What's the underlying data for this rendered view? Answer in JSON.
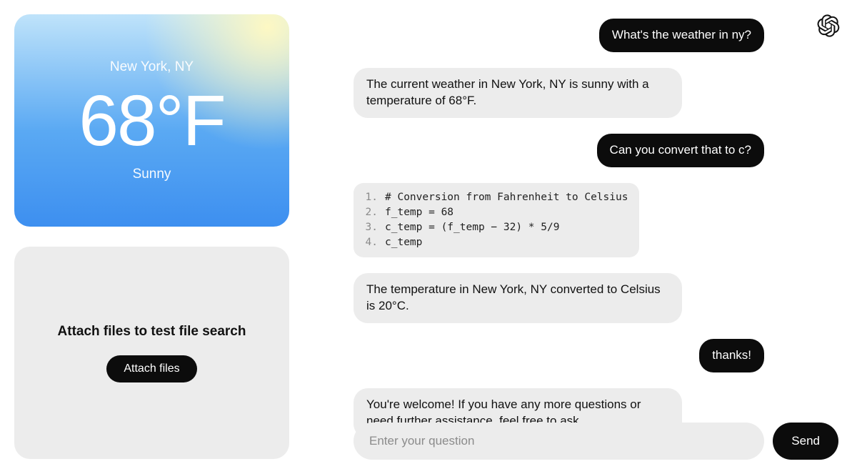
{
  "weather": {
    "location": "New York, NY",
    "temp": "68°F",
    "condition": "Sunny"
  },
  "attach": {
    "title": "Attach files to test file search",
    "button": "Attach files"
  },
  "chat": {
    "messages": [
      {
        "role": "user",
        "text": "What's the weather in ny?"
      },
      {
        "role": "assistant",
        "text": "The current weather in New York, NY is sunny with a temperature of 68°F."
      },
      {
        "role": "user",
        "text": "Can you convert that to c?"
      },
      {
        "role": "code",
        "lines": [
          "# Conversion from Fahrenheit to Celsius",
          "f_temp = 68",
          "c_temp = (f_temp − 32) * 5/9",
          "c_temp"
        ]
      },
      {
        "role": "assistant",
        "text": "The temperature in New York, NY converted to Celsius is 20°C."
      },
      {
        "role": "user",
        "text": "thanks!"
      },
      {
        "role": "assistant",
        "text": "You're welcome! If you have any more questions or need further assistance, feel free to ask."
      }
    ],
    "input_placeholder": "Enter your question",
    "send_label": "Send"
  },
  "brand_icon": "openai-logo"
}
